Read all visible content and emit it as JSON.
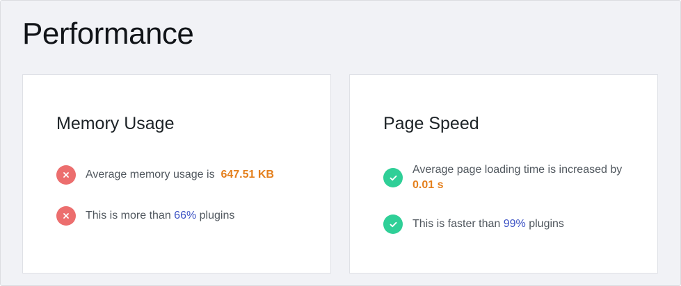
{
  "page": {
    "title": "Performance"
  },
  "memory_card": {
    "title": "Memory Usage",
    "rows": [
      {
        "status": "fail",
        "icon": "x-icon",
        "text_before": "Average memory usage is",
        "value": "647.51 KB",
        "text_after": ""
      },
      {
        "status": "fail",
        "icon": "x-icon",
        "text_before": "This is more than",
        "value": "66%",
        "text_after": "plugins"
      }
    ]
  },
  "speed_card": {
    "title": "Page Speed",
    "rows": [
      {
        "status": "pass",
        "icon": "checkmark-icon",
        "text_before": "Average page loading time is increased by",
        "value": "0.01 s",
        "text_after": ""
      },
      {
        "status": "pass",
        "icon": "checkmark-icon",
        "text_before": "This is faster than",
        "value": "99%",
        "text_after": "plugins"
      }
    ]
  },
  "colors": {
    "fail": "#ec6e6e",
    "pass": "#2fcf97",
    "value_orange": "#e47f1c",
    "value_blue": "#3b52c4"
  }
}
